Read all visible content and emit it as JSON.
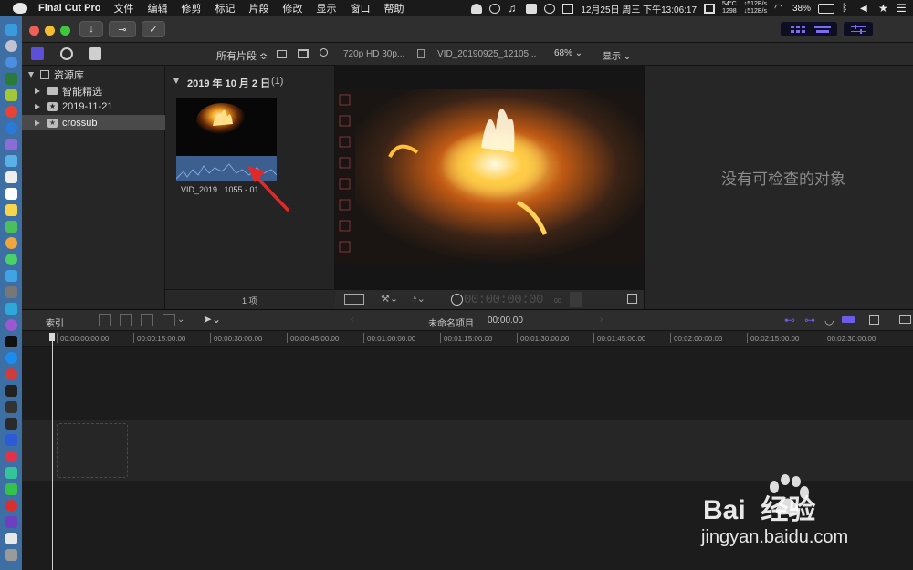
{
  "menubar": {
    "app_name": "Final Cut Pro",
    "items": [
      "文件",
      "编辑",
      "修剪",
      "标记",
      "片段",
      "修改",
      "显示",
      "窗口",
      "帮助"
    ],
    "status": {
      "temp": "54°C",
      "fan": "1298",
      "net_up": "↑512B/s",
      "net_down": "↓512B/s",
      "datetime": "12月25日 周三 下午13:06:17",
      "battery": "38%"
    }
  },
  "browser": {
    "filter_label": "所有片段 ≎",
    "library_name": "资源库",
    "library_items": [
      {
        "label": "智能精选"
      },
      {
        "label": "2019-11-21"
      },
      {
        "label": "crossub"
      }
    ],
    "group_title": "2019 年 10 月 2 日",
    "group_count": "(1)",
    "clip_name": "VID_2019...1055 - 01",
    "item_count": "1 项"
  },
  "viewer": {
    "format": "720p HD 30p...",
    "clip_title": "VID_20190925_12105...",
    "zoom": "68%",
    "display_label": "显示",
    "timecode": "00:00:00:00",
    "timecode_frames": "00"
  },
  "inspector": {
    "empty_message": "没有可检查的对象"
  },
  "timeline": {
    "index_label": "索引",
    "project_name": "未命名项目",
    "project_duration": "00:00.00",
    "ruler": [
      "00:00:00:00.00",
      "00:00:15:00.00",
      "00:00:30:00.00",
      "00:00:45:00.00",
      "00:01:00:00.00",
      "00:01:15:00.00",
      "00:01:30:00.00",
      "00:01:45:00.00",
      "00:02:00:00.00",
      "00:02:15:00.00",
      "00:02:30:00.00"
    ]
  },
  "watermark": {
    "brand": "Bai  经验",
    "url": "jingyan.baidu.com"
  },
  "colors": {
    "accent_purple": "#6c5ce7",
    "selection": "#4a4a4a",
    "audio_blue": "#3d5f90",
    "arrow_red": "#e02a2a"
  }
}
